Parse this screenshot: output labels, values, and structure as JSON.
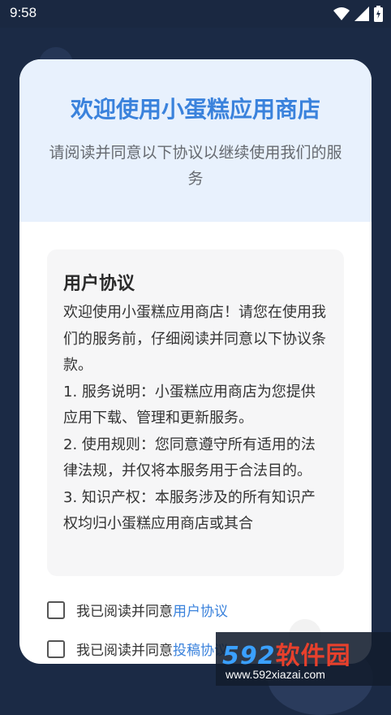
{
  "status_bar": {
    "time": "9:58",
    "icons": [
      "wifi-icon",
      "signal-icon",
      "battery-icon"
    ]
  },
  "dialog": {
    "title": "欢迎使用小蛋糕应用商店",
    "subtitle": "请阅读并同意以下协议以继续使用我们的服务",
    "agreement": {
      "heading": "用户协议",
      "paragraphs": [
        "欢迎使用小蛋糕应用商店！请您在使用我们的服务前，仔细阅读并同意以下协议条款。",
        "1. 服务说明：小蛋糕应用商店为您提供应用下载、管理和更新服务。",
        "2. 使用规则：您同意遵守所有适用的法律法规，并仅将本服务用于合法目的。",
        "3. 知识产权：本服务涉及的所有知识产权均归小蛋糕应用商店或其合"
      ]
    },
    "agree_user": {
      "prefix": "我已阅读并同意",
      "link": "用户协议"
    },
    "agree_upload": {
      "prefix": "我已阅读并同意",
      "link": "投稿协议"
    }
  },
  "watermark": {
    "logo_num": "592",
    "logo_cn": "软件园",
    "url": "www.592xiazai.com"
  },
  "colors": {
    "accent": "#3a82dc",
    "header_bg": "#e8f1fd",
    "page_bg": "#1b2a45"
  }
}
